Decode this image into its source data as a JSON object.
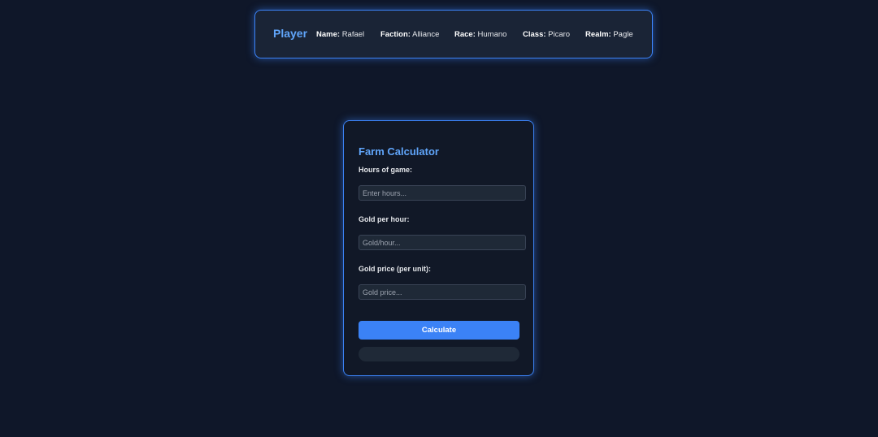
{
  "player": {
    "title": "Player",
    "fields": [
      {
        "label": "Name:",
        "value": "Rafael"
      },
      {
        "label": "Faction:",
        "value": "Alliance"
      },
      {
        "label": "Race:",
        "value": "Humano"
      },
      {
        "label": "Class:",
        "value": "Picaro"
      },
      {
        "label": "Realm:",
        "value": "Pagle"
      }
    ]
  },
  "calculator": {
    "title": "Farm Calculator",
    "hours": {
      "label": "Hours of game:",
      "placeholder": "Enter hours...",
      "value": ""
    },
    "gold_per_hour": {
      "label": "Gold per hour:",
      "placeholder": "Gold/hour...",
      "value": ""
    },
    "gold_price": {
      "label": "Gold price (per unit):",
      "placeholder": "Gold price...",
      "value": ""
    },
    "button_label": "Calculate",
    "result": ""
  },
  "colors": {
    "background": "#0f1729",
    "accent": "#3b82f6",
    "title": "#60a5fa"
  }
}
